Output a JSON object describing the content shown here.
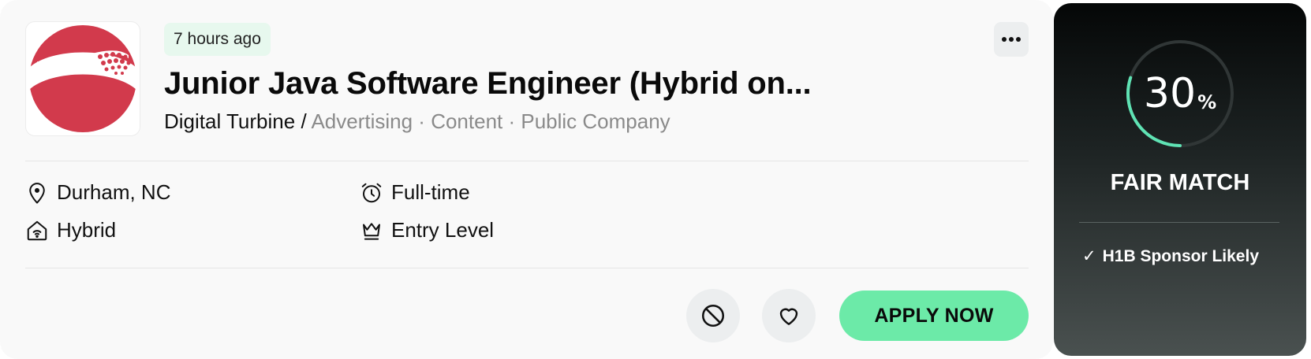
{
  "job": {
    "posted": "7 hours ago",
    "title": "Junior Java Software Engineer (Hybrid on...",
    "company": "Digital Turbine",
    "separator": "/",
    "tags": "Advertising · Content · Public Company"
  },
  "details": {
    "location": "Durham, NC",
    "employment_type": "Full-time",
    "work_mode": "Hybrid",
    "level": "Entry Level"
  },
  "actions": {
    "apply_label": "APPLY NOW"
  },
  "match": {
    "percent": "30",
    "percent_sign": "%",
    "progress": 0.3,
    "label": "FAIR MATCH",
    "sponsor_check": "✓",
    "sponsor_text": "H1B Sponsor Likely"
  },
  "icons": {
    "more": "more-horizontal-icon",
    "location": "map-pin-icon",
    "employment": "alarm-clock-icon",
    "work_mode": "home-wifi-icon",
    "level": "crown-icon",
    "block": "block-icon",
    "favorite": "heart-icon"
  },
  "colors": {
    "brand_logo": "#d23a4c",
    "accent": "#6ceaa8",
    "badge_bg": "#e7f8ee"
  }
}
